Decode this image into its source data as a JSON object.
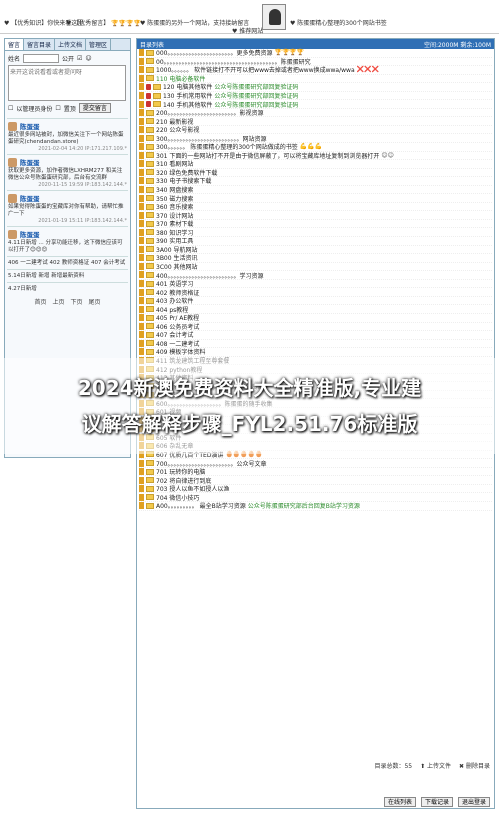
{
  "topbar": {
    "links": [
      "【优秀知识】你快来看这里",
      "【优秀留言】",
      "陈蛋蛋的另外一个网站，支持接纳留言",
      "推荐网站",
      "陈蛋蛋精心整理的300个网站书签"
    ]
  },
  "left": {
    "tabs": [
      "留言",
      "留言目录",
      "上传文档",
      "管理区"
    ],
    "form": {
      "name_label": "姓名",
      "name_value": "",
      "public_label": "公开",
      "textarea_placeholder": "来开这说说看看或者提问呀",
      "admin_label": "以管理员身份",
      "top_label": "置顶",
      "submit_label": "提交留言"
    },
    "messages": [
      {
        "who": "陈蛋蛋",
        "body": "最近很多网站被封，加微信关注下一个网站陈蛋蛋研究(chendandan.store)",
        "meta": "2021-02-04 14:20  IP:171.217.109.*"
      },
      {
        "who": "陈蛋蛋",
        "body": "获取更多资源，加作者微信LXHRM277 和关注微信公众号陈蛋蛋研究部，后台有交流群",
        "meta": "2020-11-15 19:59  IP:183.142.144.*"
      },
      {
        "who": "陈蛋蛋",
        "body": "如果觉得陈蛋蛋的宝藏库对你有帮助，请帮忙推广一下",
        "meta": "2021-01-19 15:11  IP:183.142.144.*"
      },
      {
        "who": "陈蛋蛋",
        "body": "4.11日新增 ... 分享功能迁移，这下微信应该可以打开了😊😊😊",
        "meta": ""
      },
      {
        "who": "",
        "body": "406 一二建考试  402 教师资格证  407 会计考试",
        "meta": ""
      },
      {
        "who": "",
        "body": "5.14日新增 新增 新增最新资料",
        "meta": ""
      },
      {
        "who": "",
        "body": "4.27日新增",
        "meta": ""
      }
    ],
    "pager": [
      "首页",
      "上页",
      "下页",
      "尾页"
    ]
  },
  "right": {
    "title": "目录列表",
    "space": "空间:2000M  剩余:100M",
    "rows": [
      {
        "t": "000。。。。。。。。。。。。。。。。。。。。。。更多免费资源",
        "n": "🏆🏆🏆🏆",
        "c": "green"
      },
      {
        "t": "00。。。。。。。。。。。。。。。。。。。。。。。。。。。。。。。。。。。。。。陈蛋蛋研究",
        "n": "",
        "c": ""
      },
      {
        "t": "1000。。。。。。 软件链接打不开可以把www去掉或者把www换成wwa/wwa",
        "n": "❌❌❌",
        "c": "xx"
      },
      {
        "t": "110 电脑必备软件",
        "n": "",
        "c": "green"
      },
      {
        "t": "120 电脑其他软件",
        "n": "公众号陈蛋蛋研究部回复验证码",
        "c": "green"
      },
      {
        "t": "130 手机常用软件",
        "n": "公众号陈蛋蛋研究部回复验证码",
        "c": "green"
      },
      {
        "t": "140 手机其他软件",
        "n": "公众号陈蛋蛋研究部回复验证码",
        "c": "green"
      },
      {
        "t": "200。。。。。。。。。。。。。。。。。。。。。。。影视资源",
        "n": "",
        "c": ""
      },
      {
        "t": "210 最新影视",
        "n": "",
        "c": ""
      },
      {
        "t": "220 公众号影视",
        "n": "",
        "c": ""
      },
      {
        "t": "300。。。。。。。。。。。。。。。。。。。。。。。。网站资源",
        "n": "",
        "c": ""
      },
      {
        "t": "300。。。。。。 陈蛋蛋精心整理的300个网站做成的书签",
        "n": "💪💪💪",
        "c": ""
      },
      {
        "t": "301 下面的一些网站打不开是由于微信屏蔽了，可以将宝藏库地址复制到浏览器打开",
        "n": "😊😊",
        "c": ""
      },
      {
        "t": "310 看剧网站",
        "n": "",
        "c": ""
      },
      {
        "t": "320 绿色免费软件下载",
        "n": "",
        "c": ""
      },
      {
        "t": "330 电子书搜索下载",
        "n": "",
        "c": ""
      },
      {
        "t": "340 网盘搜索",
        "n": "",
        "c": ""
      },
      {
        "t": "350 磁力搜索",
        "n": "",
        "c": ""
      },
      {
        "t": "360 音乐搜索",
        "n": "",
        "c": ""
      },
      {
        "t": "370 设计网站",
        "n": "",
        "c": ""
      },
      {
        "t": "370 素材下载",
        "n": "",
        "c": ""
      },
      {
        "t": "380 知识学习",
        "n": "",
        "c": ""
      },
      {
        "t": "390 实用工具",
        "n": "",
        "c": ""
      },
      {
        "t": "3A00 导航网站",
        "n": "",
        "c": ""
      },
      {
        "t": "3B00 生活资讯",
        "n": "",
        "c": ""
      },
      {
        "t": "3C00 其他网站",
        "n": "",
        "c": ""
      },
      {
        "t": "400。。。。。。。。。。。。。。。。。。。。。。。学习资源",
        "n": "",
        "c": ""
      },
      {
        "t": "401 英语学习",
        "n": "",
        "c": ""
      },
      {
        "t": "402 教师资格证",
        "n": "",
        "c": ""
      },
      {
        "t": "403 办公软件",
        "n": "",
        "c": ""
      },
      {
        "t": "404 ps教程",
        "n": "",
        "c": ""
      },
      {
        "t": "405 Pr/ AE教程",
        "n": "",
        "c": ""
      },
      {
        "t": "406 公务员考试",
        "n": "",
        "c": ""
      },
      {
        "t": "407 会计考试",
        "n": "",
        "c": ""
      },
      {
        "t": "408 一二建考试",
        "n": "",
        "c": ""
      },
      {
        "t": "409 模板字体资料",
        "n": "",
        "c": ""
      },
      {
        "t": "411 筑龙建筑工程至尊套餐",
        "n": "",
        "c": ""
      },
      {
        "t": "412 python教程",
        "n": "",
        "c": ""
      },
      {
        "t": "413 其他资料",
        "n": "",
        "c": ""
      },
      {
        "t": "500。。。。。。。。。。。。。。。。。。。。。。。娱乐资源",
        "n": "",
        "c": ""
      },
      {
        "t": "501 游戏资源",
        "n": "",
        "c": ""
      },
      {
        "t": "600。。。。。。。。。。。。。。。。。。陈蛋蛋的随手收集",
        "n": "",
        "c": ""
      },
      {
        "t": "601 视频",
        "n": "",
        "c": ""
      },
      {
        "t": "602 图书",
        "n": "",
        "c": ""
      },
      {
        "t": "603 音乐",
        "n": "",
        "c": ""
      },
      {
        "t": "605 软件",
        "n": "",
        "c": ""
      },
      {
        "t": "606 杂乱无章",
        "n": "",
        "c": ""
      },
      {
        "t": "607 优质几百个TED演讲",
        "n": "🥚🥚🥚🥚🥚",
        "c": ""
      },
      {
        "t": "700。。。。。。。。。。。。。。。。。。。。。。公众号文章",
        "n": "",
        "c": ""
      },
      {
        "t": "701 玩转你的电脑",
        "n": "",
        "c": ""
      },
      {
        "t": "702 将自律进行到底",
        "n": "",
        "c": ""
      },
      {
        "t": "703 授人以鱼不如授人以渔",
        "n": "",
        "c": ""
      },
      {
        "t": "704 微信小技巧",
        "n": "",
        "c": ""
      },
      {
        "t": "A00。。。。。。。。。 最全B站学习资源",
        "n": "公众号陈蛋蛋研究部后台回复B站学习资源",
        "c": "green"
      }
    ],
    "footer": {
      "count": "目录总数：55",
      "upload": "上传文件",
      "delete": "删除目录"
    },
    "buttons": [
      "在线列表",
      "下载记录",
      "退出登录"
    ]
  },
  "banner": {
    "line1": "2024新澳免费资料大全精准版,专业建",
    "line2": "议解答解释步骤_FYL2.51.76标准版"
  }
}
